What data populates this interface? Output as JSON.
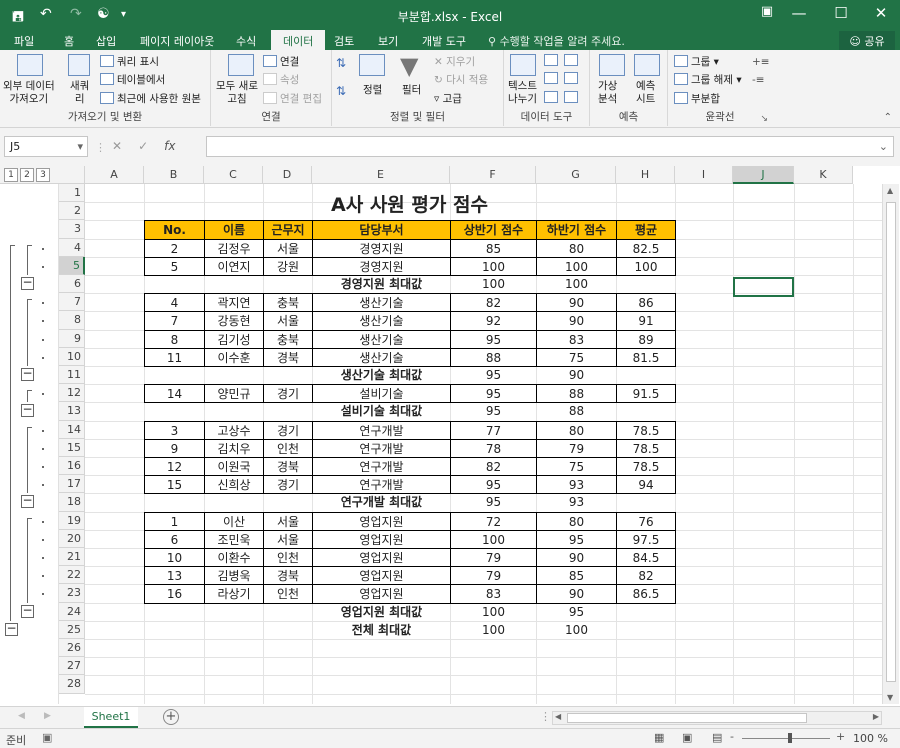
{
  "window": {
    "title": "부분합.xlsx - Excel",
    "save_icon": "save-icon",
    "undo_icon": "undo-icon",
    "redo_icon": "redo-icon",
    "ribbon_display_icon": "ribbon-display-icon",
    "minimize_icon": "minimize-icon",
    "maximize_icon": "maximize-icon",
    "close_icon": "close-icon"
  },
  "tabs": [
    "파일",
    "홈",
    "삽입",
    "페이지 레이아웃",
    "수식",
    "데이터",
    "검토",
    "보기",
    "개발 도구"
  ],
  "active_tab": "데이터",
  "tell_me": "수행할 작업을 알려 주세요.",
  "share": "공유",
  "ribbon": {
    "get_external": "외부 데이터\n가져오기",
    "new_query": "새쿼\n리",
    "show_query": "쿼리 표시",
    "from_table": "테이블에서",
    "recent_sources": "최근에 사용한 원본",
    "group1_label": "가져오기 및 변환",
    "refresh_all": "모두 새로\n고침",
    "connections": "연결",
    "properties": "속성",
    "edit_links": "연결 편집",
    "group2_label": "연결",
    "sort": "정렬",
    "filter": "필터",
    "clear": "지우기",
    "reapply": "다시 적용",
    "advanced": "고급",
    "group3_label": "정렬 및 필터",
    "text_to_columns": "텍스트\n나누기",
    "group4_label": "데이터 도구",
    "what_if": "가상\n분석",
    "forecast_sheet": "예측\n시트",
    "group5_label": "예측",
    "group": "그룹",
    "ungroup": "그룹 해제",
    "subtotal": "부분합",
    "group6_label": "윤곽선"
  },
  "formula_bar": {
    "name_box": "J5",
    "formula": "",
    "fx": "fx"
  },
  "outline_levels": [
    "1",
    "2",
    "3"
  ],
  "columns": [
    "A",
    "B",
    "C",
    "D",
    "E",
    "F",
    "G",
    "H",
    "I",
    "J",
    "K"
  ],
  "selected_column": "J",
  "selected_row": "5",
  "rows": [
    "1",
    "2",
    "3",
    "4",
    "5",
    "6",
    "7",
    "8",
    "9",
    "10",
    "11",
    "12",
    "13",
    "14",
    "15",
    "16",
    "17",
    "18",
    "19",
    "20",
    "21",
    "22",
    "23",
    "24",
    "25",
    "26",
    "27",
    "28"
  ],
  "sheet_title": "A사 사원 평가 점수",
  "table_headers": [
    "No.",
    "이름",
    "근무지",
    "담당부서",
    "상반기 점수",
    "하반기 점수",
    "평균"
  ],
  "table_rows": [
    [
      "2",
      "김정우",
      "서울",
      "경영지원",
      "85",
      "80",
      "82.5"
    ],
    [
      "5",
      "이연지",
      "강원",
      "경영지원",
      "100",
      "100",
      "100"
    ],
    [
      "",
      "",
      "",
      "경영지원 최대값",
      "100",
      "100",
      ""
    ],
    [
      "4",
      "곽지연",
      "충북",
      "생산기술",
      "82",
      "90",
      "86"
    ],
    [
      "7",
      "강동현",
      "서울",
      "생산기술",
      "92",
      "90",
      "91"
    ],
    [
      "8",
      "김기성",
      "충북",
      "생산기술",
      "95",
      "83",
      "89"
    ],
    [
      "11",
      "이수훈",
      "경북",
      "생산기술",
      "88",
      "75",
      "81.5"
    ],
    [
      "",
      "",
      "",
      "생산기술 최대값",
      "95",
      "90",
      ""
    ],
    [
      "14",
      "양민규",
      "경기",
      "설비기술",
      "95",
      "88",
      "91.5"
    ],
    [
      "",
      "",
      "",
      "설비기술 최대값",
      "95",
      "88",
      ""
    ],
    [
      "3",
      "고상수",
      "경기",
      "연구개발",
      "77",
      "80",
      "78.5"
    ],
    [
      "9",
      "김치우",
      "인천",
      "연구개발",
      "78",
      "79",
      "78.5"
    ],
    [
      "12",
      "이원국",
      "경북",
      "연구개발",
      "82",
      "75",
      "78.5"
    ],
    [
      "15",
      "신희상",
      "경기",
      "연구개발",
      "95",
      "93",
      "94"
    ],
    [
      "",
      "",
      "",
      "연구개발 최대값",
      "95",
      "93",
      ""
    ],
    [
      "1",
      "이산",
      "서울",
      "영업지원",
      "72",
      "80",
      "76"
    ],
    [
      "6",
      "조민욱",
      "서울",
      "영업지원",
      "100",
      "95",
      "97.5"
    ],
    [
      "10",
      "이환수",
      "인천",
      "영업지원",
      "79",
      "90",
      "84.5"
    ],
    [
      "13",
      "김병욱",
      "경북",
      "영업지원",
      "79",
      "85",
      "82"
    ],
    [
      "16",
      "라상기",
      "인천",
      "영업지원",
      "83",
      "90",
      "86.5"
    ],
    [
      "",
      "",
      "",
      "영업지원 최대값",
      "100",
      "95",
      ""
    ]
  ],
  "grand_total": [
    "",
    "",
    "",
    "전체 최대값",
    "100",
    "100",
    ""
  ],
  "sheet_tab": "Sheet1",
  "status": "준비",
  "zoom": "100 %"
}
